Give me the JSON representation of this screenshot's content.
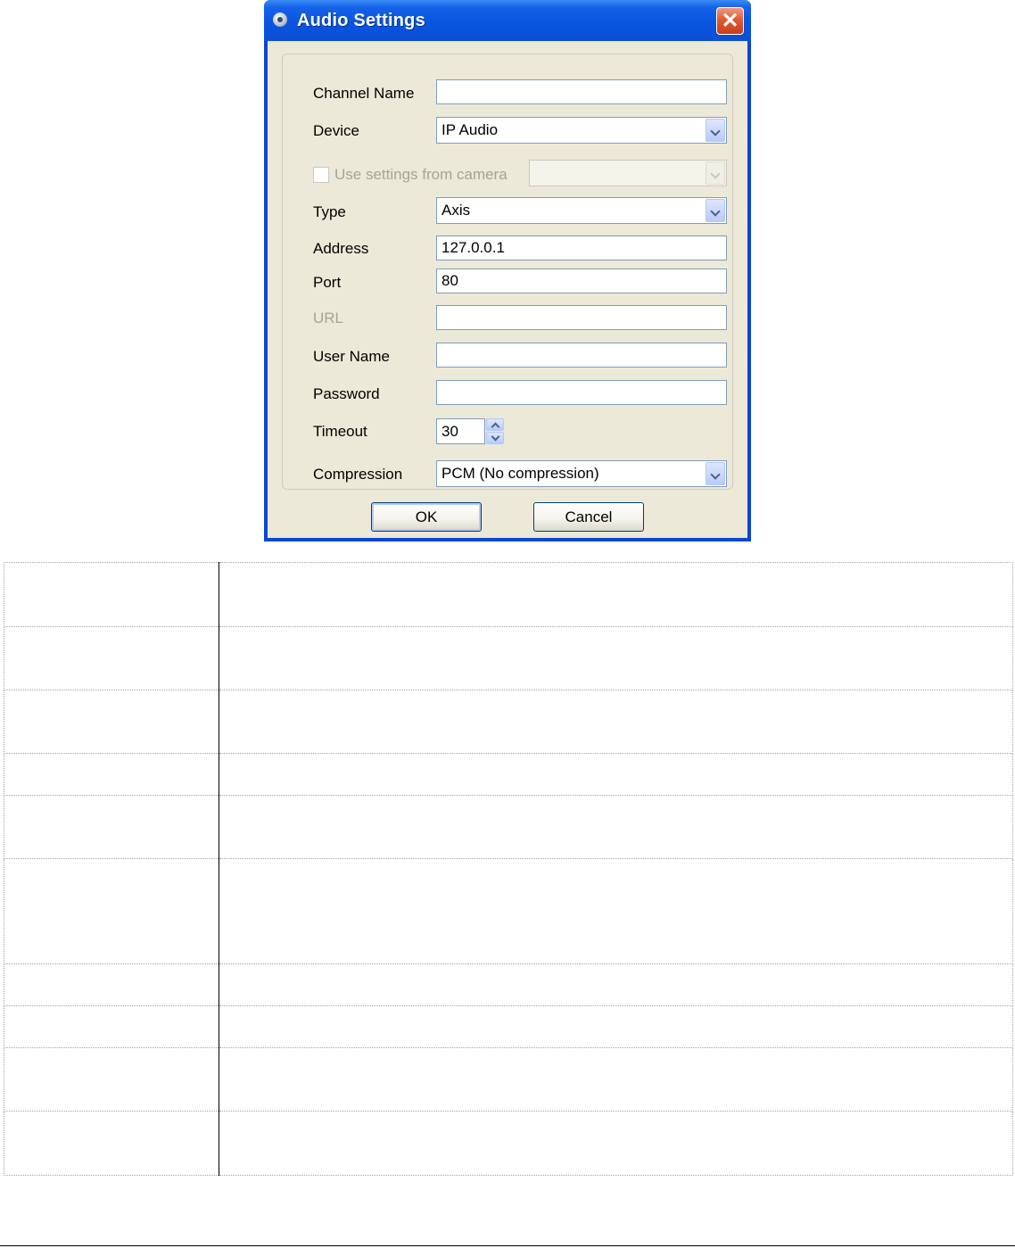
{
  "window": {
    "title": "Audio Settings",
    "close_glyph": "✕"
  },
  "form": {
    "channel_name": {
      "label": "Channel Name",
      "value": ""
    },
    "device": {
      "label": "Device",
      "value": "IP Audio"
    },
    "use_settings": {
      "label": "Use settings from camera",
      "checked": false,
      "value": ""
    },
    "type": {
      "label": "Type",
      "value": "Axis"
    },
    "address": {
      "label": "Address",
      "value": "127.0.0.1"
    },
    "port": {
      "label": "Port",
      "value": "80"
    },
    "url": {
      "label": "URL",
      "value": ""
    },
    "user_name": {
      "label": "User Name",
      "value": ""
    },
    "password": {
      "label": "Password",
      "value": ""
    },
    "timeout": {
      "label": "Timeout",
      "value": "30"
    },
    "compression": {
      "label": "Compression",
      "value": "PCM (No compression)"
    }
  },
  "buttons": {
    "ok": "OK",
    "cancel": "Cancel"
  },
  "table": {
    "rows": [
      {
        "height": 72
      },
      {
        "height": 71
      },
      {
        "height": 71
      },
      {
        "height": 47
      },
      {
        "height": 71
      },
      {
        "height": 118
      },
      {
        "height": 47
      },
      {
        "height": 47
      },
      {
        "height": 71
      },
      {
        "height": 72
      }
    ]
  },
  "colors": {
    "titlebar": "#0a55e0",
    "dialog_bg": "#ece9d8",
    "close": "#de5a34",
    "input_border": "#7f9db9"
  }
}
